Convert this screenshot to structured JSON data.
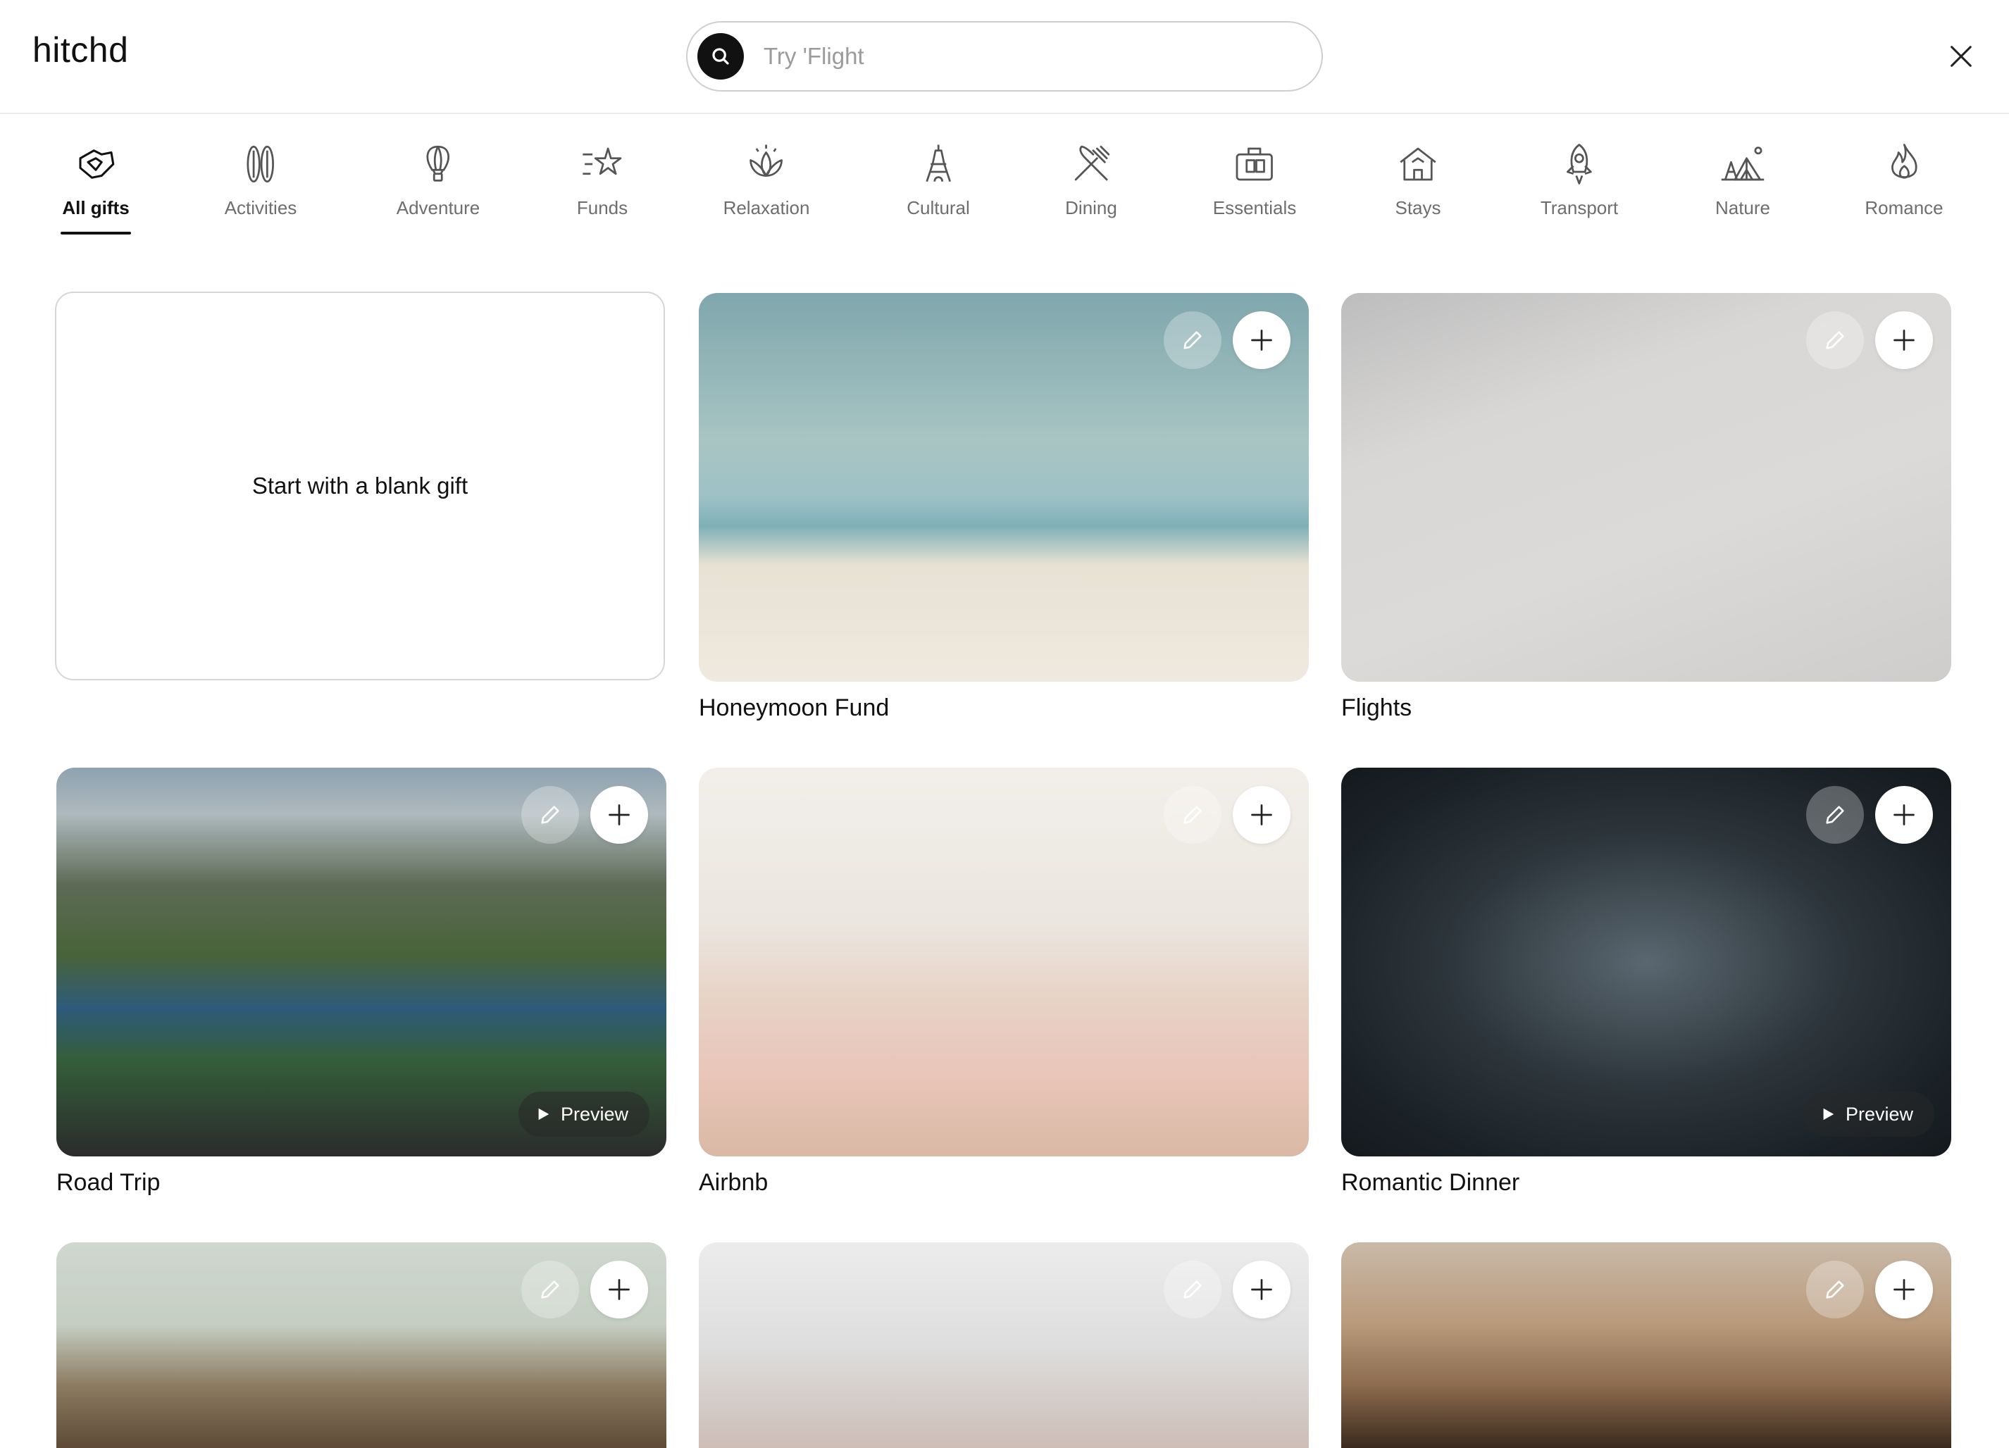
{
  "header": {
    "logo": "hitchd",
    "search": {
      "placeholder": "Try 'Flight"
    }
  },
  "categories": [
    {
      "label": "All gifts",
      "icon": "gifts-icon",
      "active": true
    },
    {
      "label": "Activities",
      "icon": "surfboards-icon",
      "active": false
    },
    {
      "label": "Adventure",
      "icon": "hot-air-balloon-icon",
      "active": false
    },
    {
      "label": "Funds",
      "icon": "sparkle-star-icon",
      "active": false
    },
    {
      "label": "Relaxation",
      "icon": "lotus-icon",
      "active": false
    },
    {
      "label": "Cultural",
      "icon": "eiffel-tower-icon",
      "active": false
    },
    {
      "label": "Dining",
      "icon": "fork-knife-icon",
      "active": false
    },
    {
      "label": "Essentials",
      "icon": "luggage-icon",
      "active": false
    },
    {
      "label": "Stays",
      "icon": "house-icon",
      "active": false
    },
    {
      "label": "Transport",
      "icon": "rocket-icon",
      "active": false
    },
    {
      "label": "Nature",
      "icon": "tent-icon",
      "active": false
    },
    {
      "label": "Romance",
      "icon": "flame-icon",
      "active": false
    }
  ],
  "blank_card": {
    "label": "Start with a blank gift"
  },
  "gifts": [
    {
      "title": "Honeymoon Fund",
      "preview": ""
    },
    {
      "title": "Flights",
      "preview": ""
    },
    {
      "title": "Road Trip",
      "preview": "Preview"
    },
    {
      "title": "Airbnb",
      "preview": ""
    },
    {
      "title": "Romantic Dinner",
      "preview": "Preview"
    }
  ],
  "colors": {
    "text": "#111111",
    "muted": "#6e6e6e",
    "border": "#d6d6d6"
  }
}
